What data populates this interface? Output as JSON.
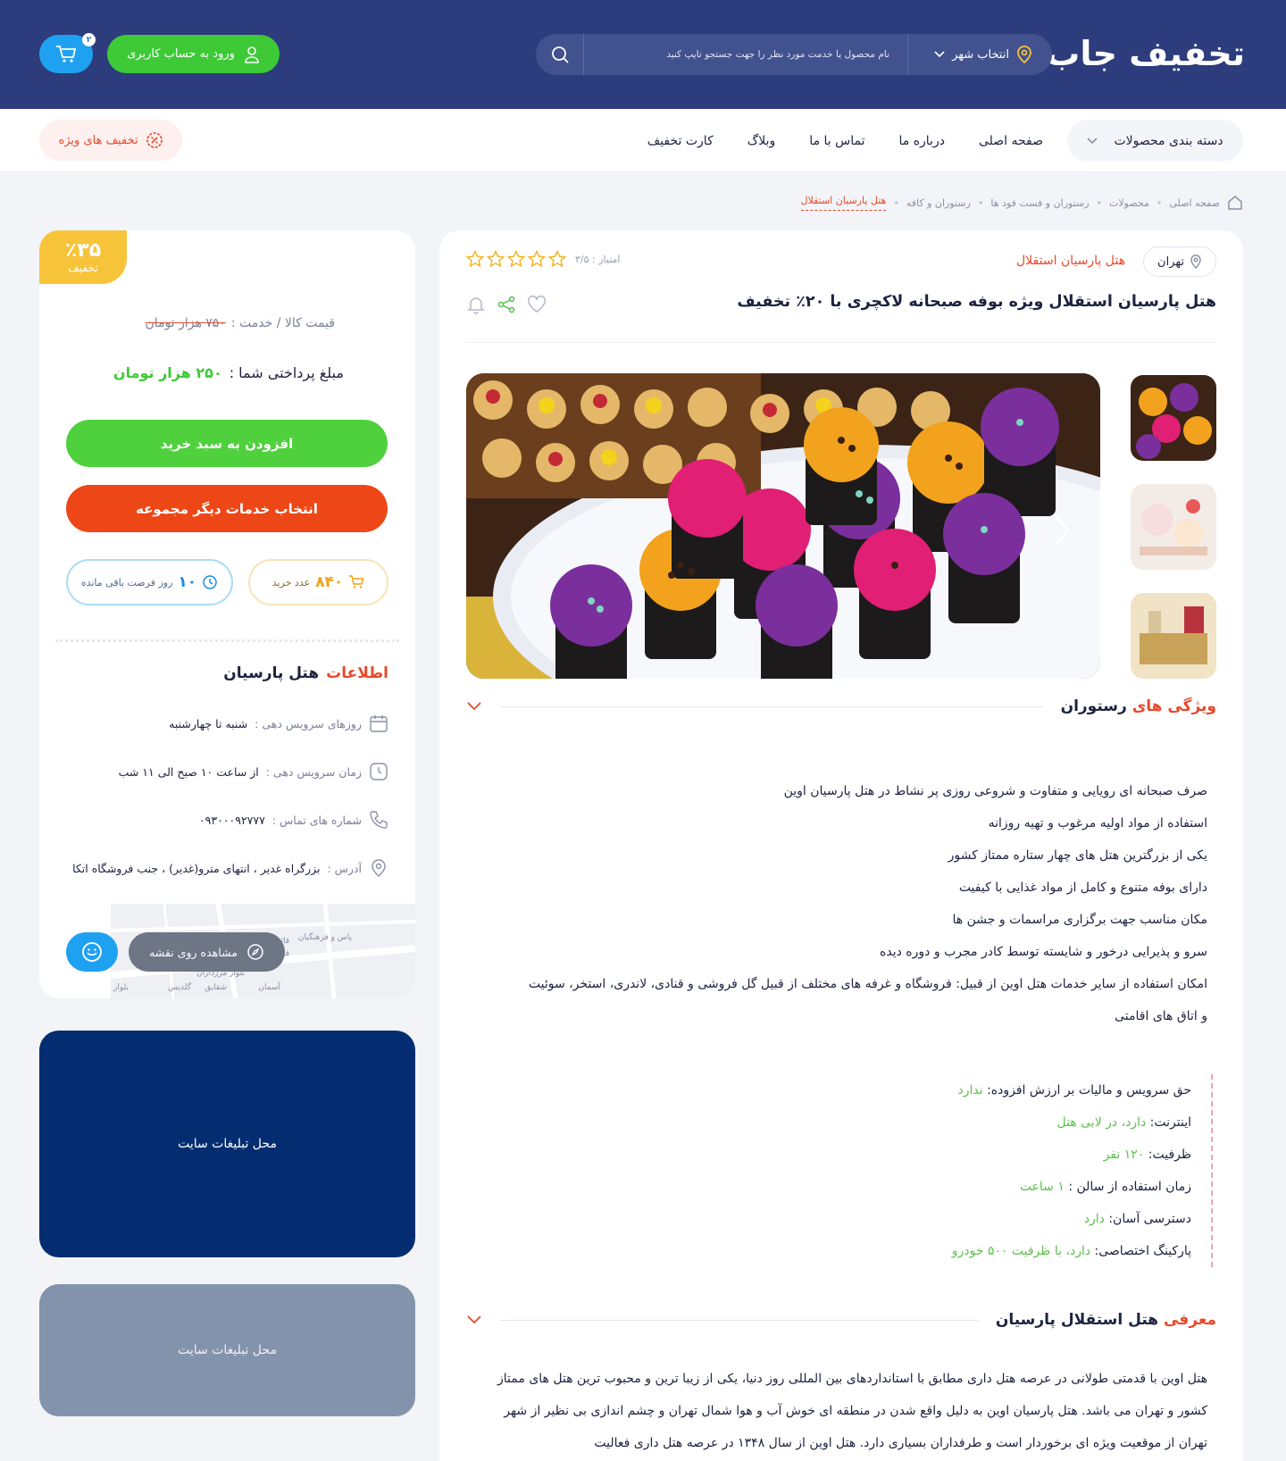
{
  "header": {
    "logo": "تخفیف جاب",
    "city_label": "انتخاب شهر",
    "search_placeholder": "نام محصول یا خدمت مورد نظر را جهت جستجو تایپ کنید",
    "login_label": "ورود به حساب کاربری",
    "cart_count": "۲"
  },
  "nav": {
    "categories_label": "دسته بندی محصولات",
    "links": [
      "صفحه اصلی",
      "درباره ما",
      "تماس با ما",
      "وبلاگ",
      "کارت تخفیف"
    ],
    "special_label": "تخفیف های ویژه"
  },
  "breadcrumb": [
    "صفحه اصلی",
    "محصولات",
    "رستوران و فست فود ها",
    "رستوران و کافه",
    "هتل پارسیان استقلال"
  ],
  "product": {
    "city": "تهران",
    "hotel_link": "هتل پارسیان استقلال",
    "rating_label": "امتیاز : ۳/۵",
    "rating_value": 3.5,
    "title": "هتل پارسیان استقلال ویژه بوفه صبحانه لاکچری با ۲۰٪ تخفیف"
  },
  "features": {
    "title_highlight": "ویژگی های",
    "title_rest": "رستوران",
    "items": [
      "صرف صبحانه ای رویایی و متفاوت و شروعی روزی پر نشاط در هتل پارسیان اوین",
      "استفاده از مواد اولیه مرغوب و تهیه روزانه",
      "یکی از بزرگترین هتل های چهار ستاره ممتاز کشور",
      "دارای بوفه متنوع و کامل از مواد غذایی با کیفیت",
      "مکان مناسب جهت برگزاری مراسمات و جشن ها",
      "سرو و پذیرایی درخور و شایسته توسط کادر مجرب و دوره دیده",
      "امکان استفاده از سایر خدمات هتل اوین از قبیل: فروشگاه و غرفه های مختلف از قبیل گل فروشی و قنادی، لاندری، استخر، سوئیت",
      "و اتاق های اقامتی"
    ]
  },
  "specs": [
    {
      "label": "حق سرویس و مالیات بر ارزش افزوده:",
      "value": "ندارد"
    },
    {
      "label": "اینترنت:",
      "value": "دارد، در لابی هتل"
    },
    {
      "label": "ظرفیت:",
      "value": "۱۲۰ نفر"
    },
    {
      "label": "زمان استفاده از سالن :",
      "value": "۱ ساعت"
    },
    {
      "label": "دسترسی آسان:",
      "value": "دارد"
    },
    {
      "label": "پارکینگ اختصاصی:",
      "value": "دارد، با ظرفیت ۵۰۰ خودرو"
    }
  ],
  "intro": {
    "title_highlight": "معرفی",
    "title_rest": "هتل استقلال پارسیان",
    "text": "هتل اوین با قدمتی طولانی در عرصه هتل داری مطابق با استانداردهای بین المللی روز دنیا، یکی از زیبا ترین و محبوب ترین هتل های ممتاز کشور و تهران می باشد. هتل پارسیان اوین به دلیل واقع شدن در منطقه ای خوش آب و هوا شمال تهران و چشم اندازی بی نظیر از شهر تهران از موقعیت ویژه ای برخوردار است و طرفداران بسیاری دارد. هتل اوین از سال ۱۳۴۸ در عرصه هتل داری فعالیت"
  },
  "sidebar": {
    "discount_pct": "٪۳۵",
    "discount_label": "تخفیف",
    "price_label": "قیمت کالا / خدمت :",
    "old_price": "۷۵۰ هزار تومان",
    "pay_label": "مبلغ پرداختی شما :",
    "new_price": "۲۵۰ هزار تومان",
    "add_to_cart": "افزودن به سبد خرید",
    "select_other": "انتخاب خدمات دیگر مجموعه",
    "sold_count": "۸۴۰",
    "sold_label": "عدد خرید",
    "days_count": "۱۰",
    "days_label": "روز فرصت باقی مانده",
    "info_title_highlight": "اطلاعات",
    "info_title_rest": "هتل پارسیان",
    "days_key": "روزهای سرویس دهی :",
    "days_val": "شنبه تا چهارشنبه",
    "time_key": "زمان سرویس دهی :",
    "time_val": "از ساعت ۱۰ صبح الی ۱۱ شب",
    "phone_key": "شماره های تماس :",
    "phone_val": "۰۹۳۰۰۰۹۲۷۷۷",
    "addr_key": "آدرس :",
    "addr_val": "بزرگراه غدیر ، انتهای مترو(غدیر) ، جنب فروشگاه اتکا",
    "map_button": "مشاهده روی نقشه",
    "map_labels": [
      "بلوار مرزداران",
      "شقایق",
      "آسمان",
      "گلدیس",
      "پاس و فرهنگیان",
      "بلوار مرزداران",
      "قائم ۲",
      "قائم ۱"
    ]
  },
  "ads": {
    "ad1": "محل تبلیغات سایت",
    "ad2": "محل تبلیغات سایت"
  },
  "colors": {
    "header_bg": "#2c3c7c",
    "accent_red": "#e8492c",
    "green": "#3ec937",
    "blue": "#1fa1f1",
    "badge_yellow": "#f7c339"
  }
}
